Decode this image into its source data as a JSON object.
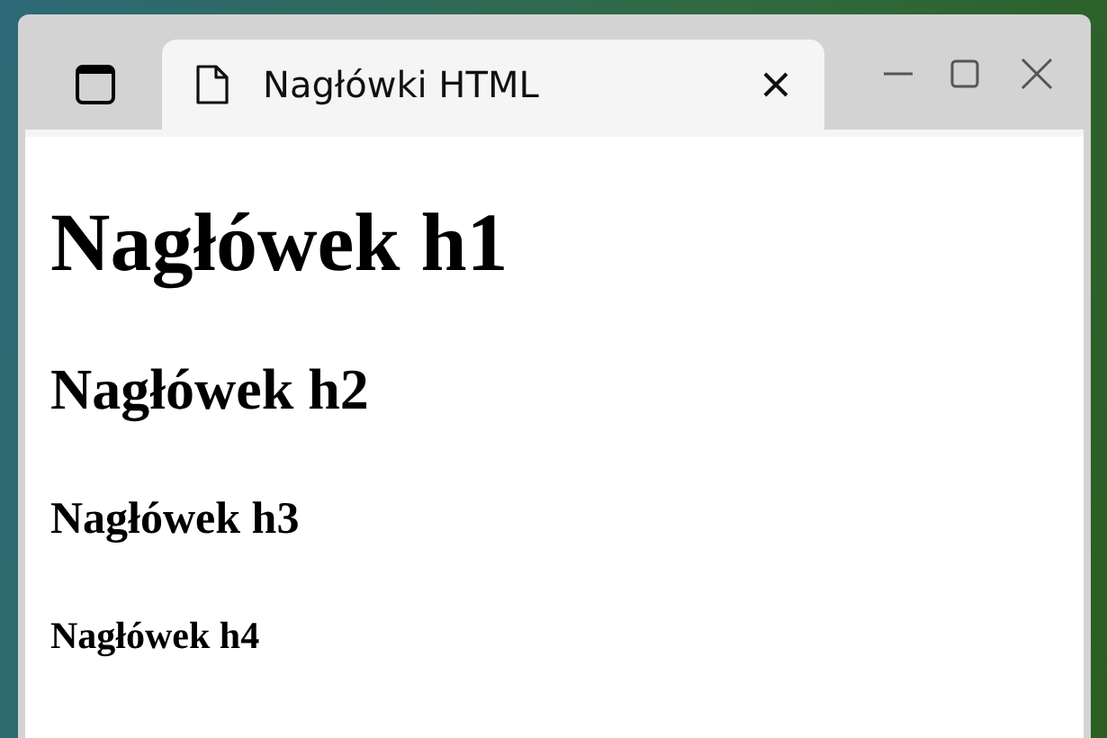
{
  "tab": {
    "title": "Nagłówki HTML"
  },
  "headings": [
    {
      "kind": "h1",
      "text": "Nagłówek h1"
    },
    {
      "kind": "h2",
      "text": "Nagłówek h2"
    },
    {
      "kind": "h3",
      "text": "Nagłówek h3"
    },
    {
      "kind": "h4",
      "text": "Nagłówek h4"
    }
  ]
}
